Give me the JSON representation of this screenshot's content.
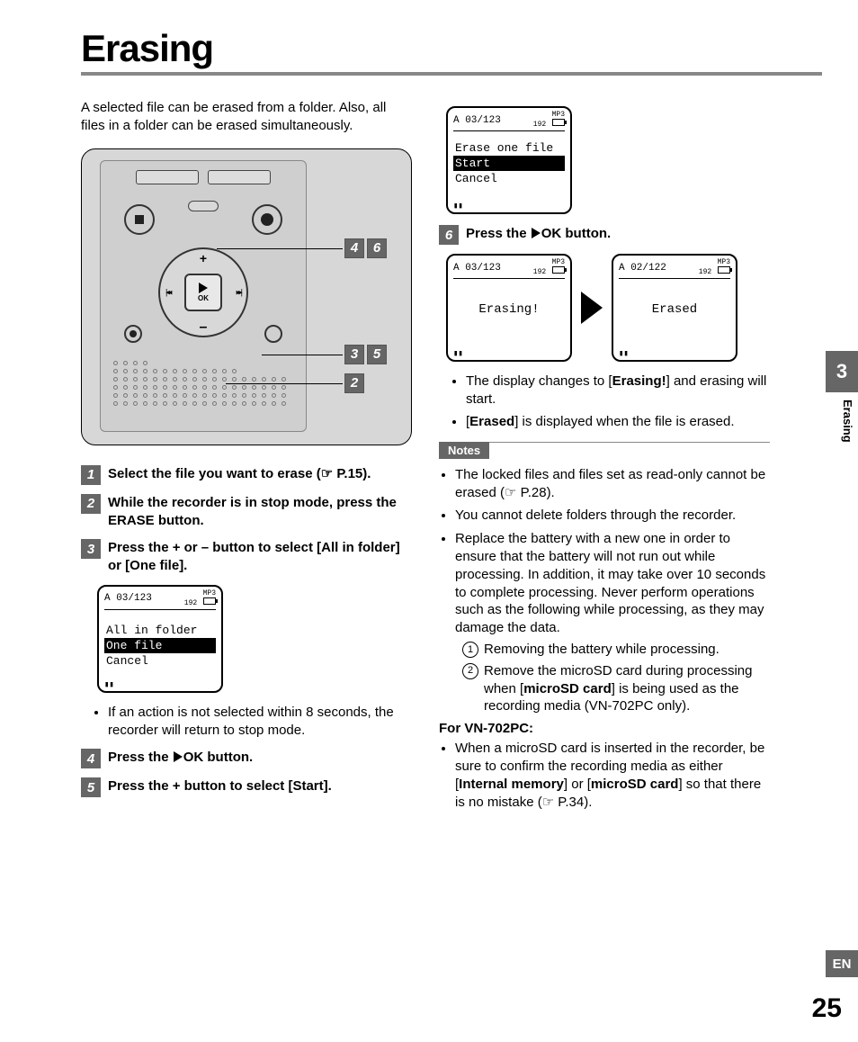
{
  "page": {
    "title": "Erasing",
    "intro": "A selected file can be erased from a folder. Also, all files in a folder can be erased simultaneously.",
    "section_number": "3",
    "side_label": "Erasing",
    "lang": "EN",
    "page_number": "25"
  },
  "diagram": {
    "ok_label": "OK",
    "callouts": {
      "a": "4",
      "b": "6",
      "c": "3",
      "d": "5",
      "e": "2"
    }
  },
  "steps": {
    "s1": "Select the file you want to erase (☞ P.15).",
    "s2_a": "While the recorder is in stop mode, press the ",
    "s2_b": "ERASE",
    "s2_c": " button.",
    "s3_a": "Press the + or – button to select [",
    "s3_b": "All in folder",
    "s3_c": "] or [",
    "s3_d": "One file",
    "s3_e": "].",
    "s3_note": "If an action is not selected within 8 seconds, the recorder will return to stop mode.",
    "s4_a": "Press the ",
    "s4_b": "OK",
    "s4_c": " button.",
    "s5_a": "Press the + button to select [",
    "s5_b": "Start",
    "s5_c": "].",
    "s6_a": "Press the ",
    "s6_b": "OK",
    "s6_c": " button.",
    "s6_bullet1_a": "The display changes to [",
    "s6_bullet1_b": "Erasing!",
    "s6_bullet1_c": "] and erasing will start.",
    "s6_bullet2_a": "[",
    "s6_bullet2_b": "Erased",
    "s6_bullet2_c": "] is displayed when the file is erased."
  },
  "lcd": {
    "hdr_a": "A 03/123",
    "hdr_b": "A 02/122",
    "mp3": "MP3",
    "rate": "192",
    "menu1": {
      "l1": "All in folder",
      "l2": "One file",
      "l3": "Cancel"
    },
    "menu2": {
      "title": "Erase one file",
      "l1": "Start",
      "l2": "Cancel"
    },
    "erasing": "Erasing!",
    "erased": "Erased"
  },
  "notes": {
    "label": "Notes",
    "n1": "The locked files and files set as read-only cannot be erased (☞ P.28).",
    "n2": "You cannot delete folders through the recorder.",
    "n3": "Replace the battery with a new one in order to ensure that the battery will not run out while processing. In addition, it may take over 10 seconds to complete processing. Never perform operations such as the following while processing, as they may damage the data.",
    "n3_1": "Removing the battery while processing.",
    "n3_2a": "Remove the microSD card during processing when [",
    "n3_2b": "microSD card",
    "n3_2c": "] is being used as the recording media (VN-702PC only).",
    "model_hdr": "For VN-702PC:",
    "n4_a": "When a microSD card is inserted in the recorder, be sure to confirm the recording media as either [",
    "n4_b": "Internal memory",
    "n4_c": "] or [",
    "n4_d": "microSD card",
    "n4_e": "] so that there is no mistake (☞ P.34)."
  }
}
